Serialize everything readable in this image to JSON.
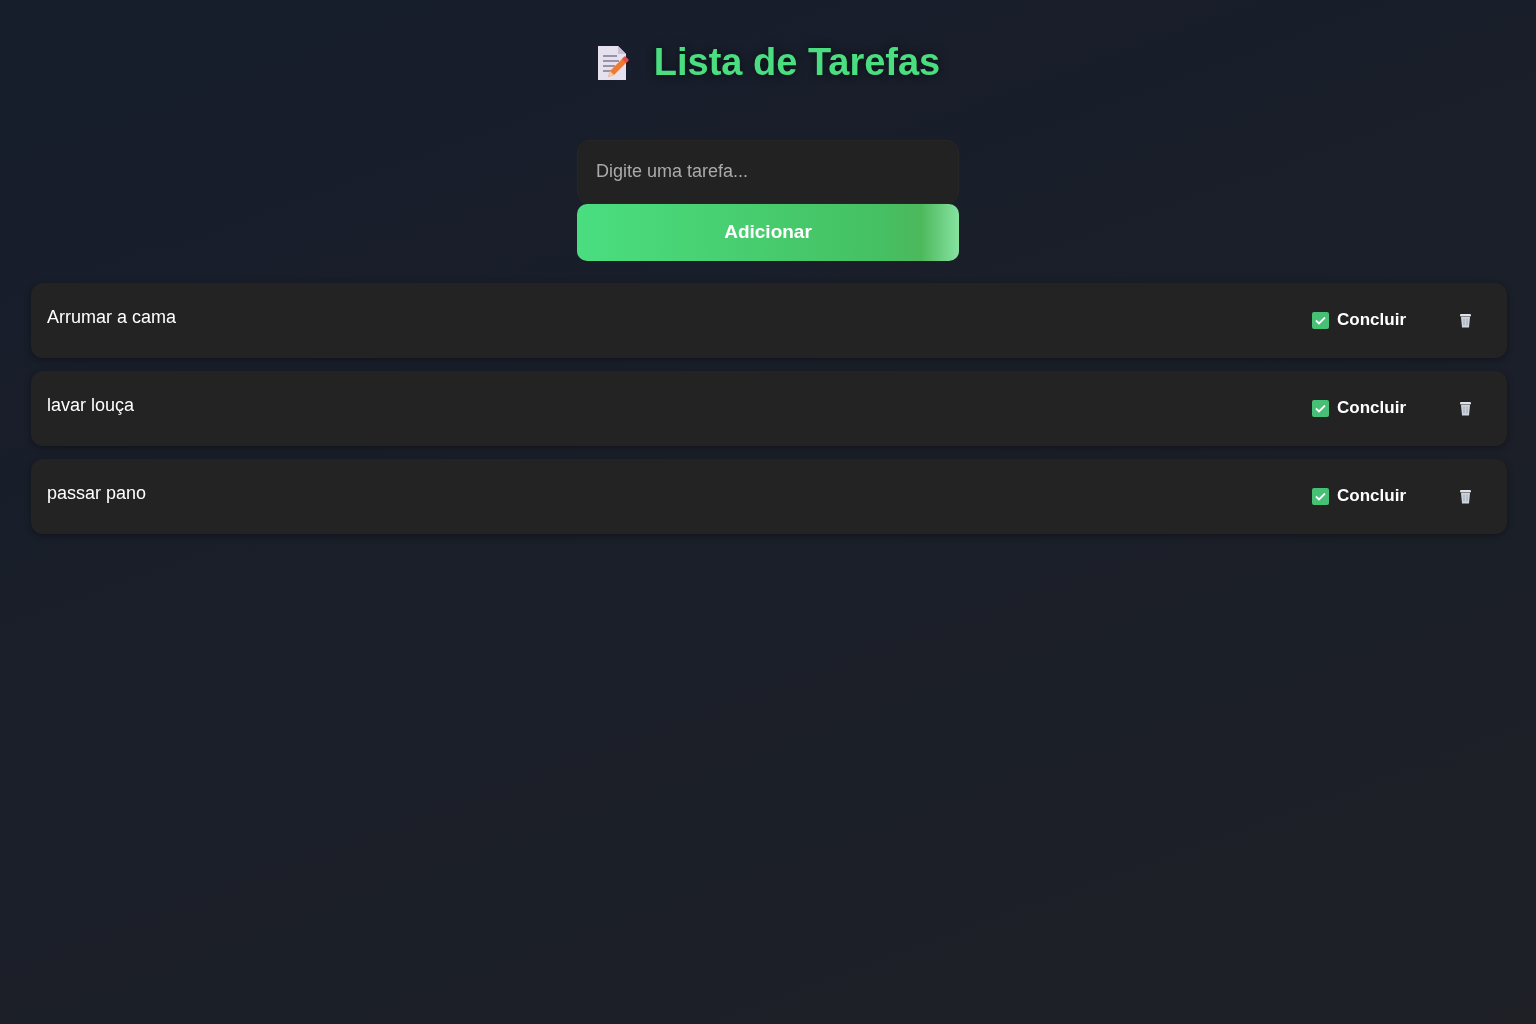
{
  "title": "Lista de Tarefas",
  "task_input": {
    "placeholder": "Digite uma tarefa..."
  },
  "add_button": "Adicionar",
  "tasks": [
    {
      "text": "Arrumar a cama",
      "complete_label": "Concluir"
    },
    {
      "text": "lavar louça",
      "complete_label": "Concluir"
    },
    {
      "text": "passar pano",
      "complete_label": "Concluir"
    }
  ]
}
